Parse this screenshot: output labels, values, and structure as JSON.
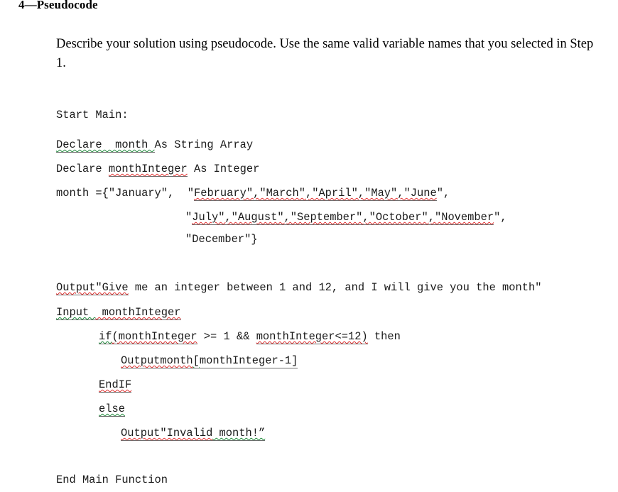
{
  "document": {
    "heading": "4—Pseudocode",
    "intro": "Describe your solution using pseudocode. Use the same valid variable names that you selected in Step 1.",
    "spellcheck_colors": {
      "spelling": "#e03030",
      "grammar": "#1f8a3b",
      "field_underline": "#6d6d6d"
    },
    "pseudocode": {
      "lines": [
        {
          "id": "start-main",
          "indent": 0,
          "text": "Start Main:",
          "segments": [
            {
              "text": "Start Main:",
              "mark": "none"
            }
          ]
        },
        {
          "id": "declare-month",
          "indent": 0,
          "text": "Declare  month As String Array",
          "segments": [
            {
              "text": "Declare  month ",
              "mark": "grammar",
              "underline": true
            },
            {
              "text": "As String Array",
              "mark": "none"
            }
          ]
        },
        {
          "id": "declare-monthinteger",
          "indent": 0,
          "text": "Declare monthInteger As Integer",
          "segments": [
            {
              "text": "Declare ",
              "mark": "none"
            },
            {
              "text": "monthInteger",
              "mark": "spelling",
              "underline": true
            },
            {
              "text": " As Integer",
              "mark": "none"
            }
          ]
        },
        {
          "id": "month-array-1",
          "indent": 0,
          "text": "month ={\"January\",  \"February\",\"March\",\"April\",\"May\",\"June\",",
          "segments": [
            {
              "text": "month ={\"January\",  \"",
              "mark": "none"
            },
            {
              "text": "February\",\"March\",\"April\",\"May\",\"June",
              "mark": "spelling",
              "underline": true
            },
            {
              "text": "\",",
              "mark": "none"
            }
          ]
        },
        {
          "id": "month-array-2",
          "indent": 3,
          "text": "\"July\",\"August\",\"September\",\"October\",\"November\",",
          "segments": [
            {
              "text": "\"",
              "mark": "none"
            },
            {
              "text": "July\",\"August\",\"September\",\"October\",\"November",
              "mark": "spelling",
              "underline": true
            },
            {
              "text": "\",",
              "mark": "none"
            }
          ]
        },
        {
          "id": "month-array-3",
          "indent": 3,
          "text": "\"December\"}",
          "segments": [
            {
              "text": "\"December\"}",
              "mark": "none"
            }
          ]
        },
        {
          "id": "blank-1",
          "indent": 0,
          "text": " ",
          "segments": [
            {
              "text": " ",
              "mark": "none"
            }
          ]
        },
        {
          "id": "output-prompt",
          "indent": 0,
          "text": "Output\"Give me an integer between 1 and 12, and I will give you the month\"",
          "segments": [
            {
              "text": "Output\"Give",
              "mark": "spelling",
              "underline": true
            },
            {
              "text": " me an integer between 1 and 12, and I will give you the month\"",
              "mark": "none"
            }
          ]
        },
        {
          "id": "input-monthinteger",
          "indent": 0,
          "text": "Input  monthInteger",
          "segments": [
            {
              "text": "Input ",
              "mark": "grammar",
              "underline": true
            },
            {
              "text": " monthInteger",
              "mark": "spelling",
              "underline": true
            }
          ]
        },
        {
          "id": "if-condition",
          "indent": 1,
          "text": "if(monthInteger >= 1 && monthInteger<=12) then",
          "segments": [
            {
              "text": "if",
              "mark": "grammar",
              "underline": true
            },
            {
              "text": "(monthInteger",
              "mark": "spelling",
              "underline": true
            },
            {
              "text": " >= 1 && ",
              "mark": "none"
            },
            {
              "text": "monthInteger<=12)",
              "mark": "spelling",
              "underline": true
            },
            {
              "text": " then",
              "mark": "none"
            }
          ]
        },
        {
          "id": "output-month",
          "indent": 2,
          "text": "Outputmonth[monthInteger-1]",
          "segments": [
            {
              "text": "Outputmonth",
              "mark": "spelling",
              "underline": true
            },
            {
              "text": "[",
              "mark": "grammar",
              "underline": true
            },
            {
              "text": "monthInteger-1]",
              "mark": "none",
              "underline": true
            }
          ]
        },
        {
          "id": "endif",
          "indent": 1,
          "text": "EndIF",
          "segments": [
            {
              "text": "EndIF",
              "mark": "spelling",
              "underline": true
            }
          ]
        },
        {
          "id": "else",
          "indent": 1,
          "text": "else",
          "segments": [
            {
              "text": "else",
              "mark": "grammar",
              "underline": true
            }
          ]
        },
        {
          "id": "output-invalid",
          "indent": 2,
          "text": "Output\"Invalid month!”",
          "segments": [
            {
              "text": "Output\"Invalid",
              "mark": "spelling",
              "underline": true
            },
            {
              "text": " month!”",
              "mark": "grammar",
              "underline": true
            }
          ]
        },
        {
          "id": "blank-2",
          "indent": 0,
          "text": " ",
          "segments": [
            {
              "text": " ",
              "mark": "none"
            }
          ]
        },
        {
          "id": "end-main",
          "indent": 0,
          "text": "End Main Function",
          "segments": [
            {
              "text": "End Main Function",
              "mark": "none"
            }
          ]
        }
      ]
    }
  }
}
